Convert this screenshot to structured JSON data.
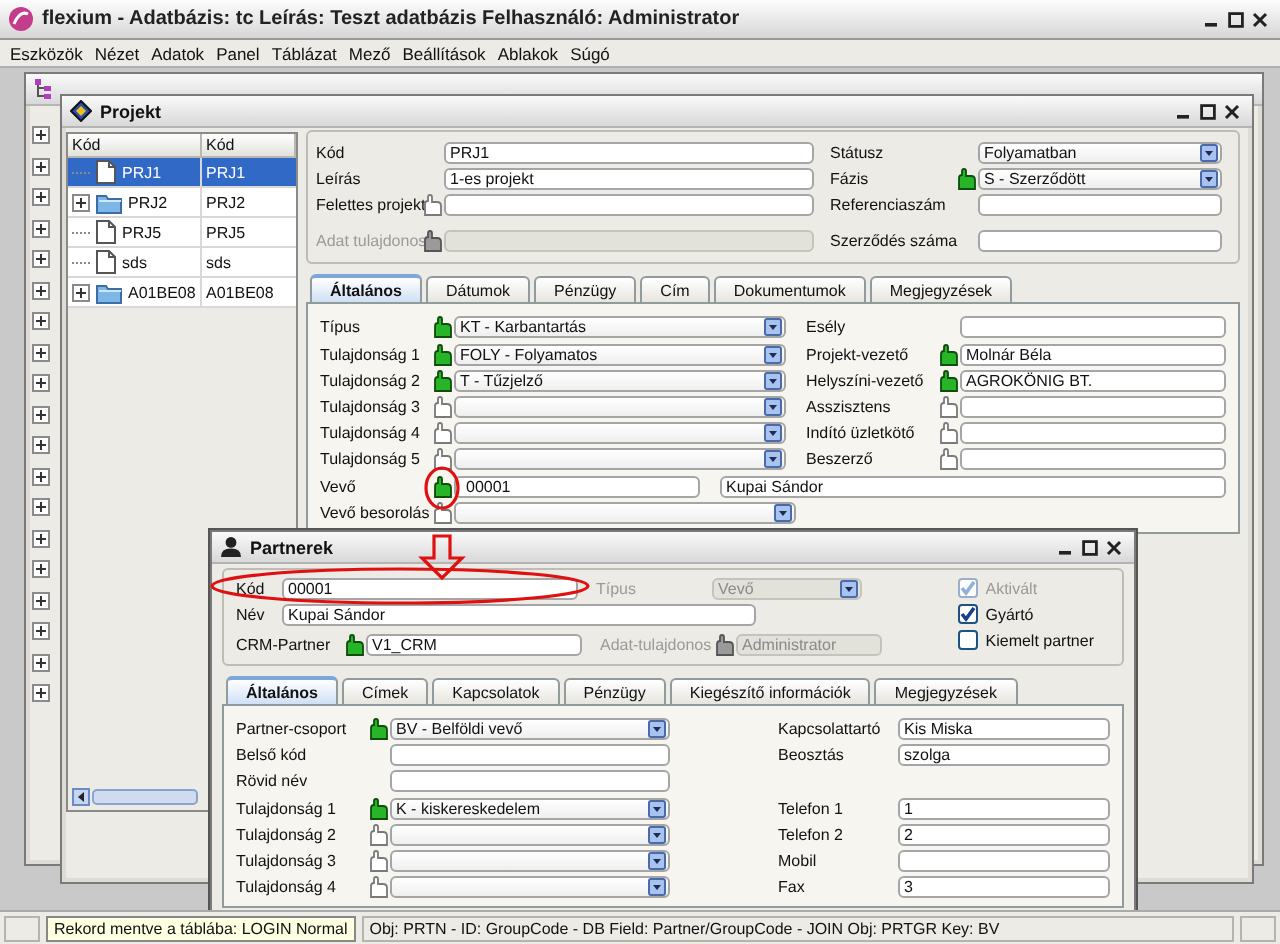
{
  "app": {
    "title": "flexium - Adatbázis: tc  Leírás: Teszt adatbázis  Felhasználó: Administrator"
  },
  "menu": [
    "Eszközök",
    "Nézet",
    "Adatok",
    "Panel",
    "Táblázat",
    "Mező",
    "Beállítások",
    "Ablakok",
    "Súgó"
  ],
  "project": {
    "title": "Projekt",
    "tree": {
      "columns": [
        "Kód",
        "Kód"
      ],
      "rows": [
        {
          "name": "PRJ1",
          "code": "PRJ1",
          "kind": "document",
          "selected": true
        },
        {
          "name": "PRJ2",
          "code": "PRJ2",
          "kind": "folder",
          "selected": false
        },
        {
          "name": "PRJ5",
          "code": "PRJ5",
          "kind": "document",
          "selected": false
        },
        {
          "name": "sds",
          "code": "sds",
          "kind": "document",
          "selected": false
        },
        {
          "name": "A01BE08",
          "code": "A01BE08",
          "kind": "folder",
          "selected": false
        }
      ]
    },
    "header": [
      [
        {
          "label": "Kód",
          "value": "PRJ1",
          "kind": "text",
          "disabled": false
        },
        {
          "label": "Leírás",
          "value": "1-es projekt",
          "kind": "text",
          "disabled": false
        },
        {
          "label": "Felettes projekt",
          "kind": "text",
          "linked": false,
          "disabled": false
        },
        {
          "label": "Adat tulajdonos",
          "kind": "text",
          "linked": true,
          "disabled": true
        }
      ],
      [
        {
          "label": "Státusz",
          "value": "Folyamatban",
          "kind": "select",
          "disabled": false
        },
        {
          "label": "Fázis",
          "value": "S - Szerződött",
          "kind": "select",
          "linked": true,
          "disabled": false
        },
        {
          "label": "Referenciaszám",
          "kind": "text",
          "disabled": false
        },
        {
          "label": "Szerződés száma",
          "kind": "text",
          "disabled": false
        }
      ]
    ],
    "tabs": [
      {
        "label": "Általános",
        "selected": true
      },
      {
        "label": "Dátumok",
        "selected": false
      },
      {
        "label": "Pénzügy",
        "selected": false
      },
      {
        "label": "Cím",
        "selected": false
      },
      {
        "label": "Dokumentumok",
        "selected": false
      },
      {
        "label": "Megjegyzések",
        "selected": false
      }
    ],
    "general": {
      "columns": [
        [
          [
            {
              "label": "Típus",
              "value": "KT - Karbantartás",
              "kind": "select",
              "linked": true
            }
          ],
          [
            {
              "label": "Tulajdonság 1",
              "value": "FOLY - Folyamatos",
              "kind": "select",
              "linked": true
            },
            {
              "label": "Tulajdonság 2",
              "value": "T - Tűzjelző",
              "kind": "select",
              "linked": true
            },
            {
              "label": "Tulajdonság 3",
              "kind": "select",
              "linked": false
            },
            {
              "label": "Tulajdonság 4",
              "kind": "select",
              "linked": false
            },
            {
              "label": "Tulajdonság 5",
              "kind": "select",
              "linked": false
            }
          ]
        ],
        [
          [
            {
              "label": "Esély",
              "kind": "text"
            }
          ],
          [
            {
              "label": "Projekt-vezető",
              "value": "Molnár Béla",
              "kind": "text",
              "linked": true
            },
            {
              "label": "Helyszíni-vezető",
              "value": "AGROKÖNIG BT.",
              "kind": "text",
              "linked": true
            },
            {
              "label": "Asszisztens",
              "kind": "text",
              "linked": false
            },
            {
              "label": "Indító üzletkötő",
              "kind": "text",
              "linked": false
            },
            {
              "label": "Beszerző",
              "kind": "text",
              "linked": false
            }
          ]
        ]
      ],
      "customer": {
        "label": "Vevő",
        "code": "00001",
        "name": "Kupai Sándor",
        "linked": true
      },
      "customer_class": {
        "label": "Vevő besorolás",
        "kind": "select",
        "linked": false
      }
    }
  },
  "partner": {
    "title": "Partnerek",
    "code": {
      "label": "Kód",
      "value": "00001",
      "kind": "text"
    },
    "type": {
      "label": "Típus",
      "value": "Vevő",
      "kind": "select",
      "disabled": true
    },
    "name": {
      "label": "Név",
      "value": "Kupai Sándor",
      "kind": "text"
    },
    "crm": {
      "label": "CRM-Partner",
      "value": "V1_CRM",
      "kind": "text",
      "linked": true
    },
    "owner": {
      "label": "Adat-tulajdonos",
      "value": "Administrator",
      "kind": "text",
      "linked": true,
      "disabled": true
    },
    "flags": [
      {
        "label": "Aktivált",
        "checked": true,
        "disabled": true
      },
      {
        "label": "Gyártó",
        "checked": true,
        "disabled": false
      },
      {
        "label": "Kiemelt partner",
        "checked": false,
        "disabled": false
      }
    ],
    "tabs": [
      {
        "label": "Általános",
        "selected": true
      },
      {
        "label": "Címek",
        "selected": false
      },
      {
        "label": "Kapcsolatok",
        "selected": false
      },
      {
        "label": "Pénzügy",
        "selected": false
      },
      {
        "label": "Kiegészítő információk",
        "selected": false
      },
      {
        "label": "Megjegyzések",
        "selected": false
      }
    ],
    "general": {
      "columns": [
        [
          [
            {
              "label": "Partner-csoport",
              "value": "BV - Belföldi vevő",
              "kind": "select",
              "linked": true
            },
            {
              "label": "Belső kód",
              "kind": "text"
            },
            {
              "label": "Rövid név",
              "kind": "text"
            }
          ],
          [
            {
              "label": "Tulajdonság 1",
              "value": "K - kiskereskedelem",
              "kind": "select",
              "linked": true
            },
            {
              "label": "Tulajdonság 2",
              "kind": "select",
              "linked": false
            },
            {
              "label": "Tulajdonság 3",
              "kind": "select",
              "linked": false
            },
            {
              "label": "Tulajdonság 4",
              "kind": "select",
              "linked": false
            }
          ]
        ],
        [
          [
            {
              "label": "Kapcsolattartó",
              "value": "Kis Miska",
              "kind": "text"
            },
            {
              "label": "Beosztás",
              "value": "szolga",
              "kind": "text"
            }
          ],
          [
            {
              "label": "Telefon 1",
              "value": "1",
              "kind": "text"
            },
            {
              "label": "Telefon 2",
              "value": "2",
              "kind": "text"
            },
            {
              "label": "Mobil",
              "kind": "text"
            },
            {
              "label": "Fax",
              "value": "3",
              "kind": "text"
            }
          ]
        ]
      ]
    }
  },
  "status_bar": {
    "message": "Rekord mentve a táblába: LOGIN Normal",
    "info": "Obj: PRTN - ID: GroupCode - DB Field: Partner/GroupCode - JOIN Obj: PRTGR Key: BV"
  }
}
